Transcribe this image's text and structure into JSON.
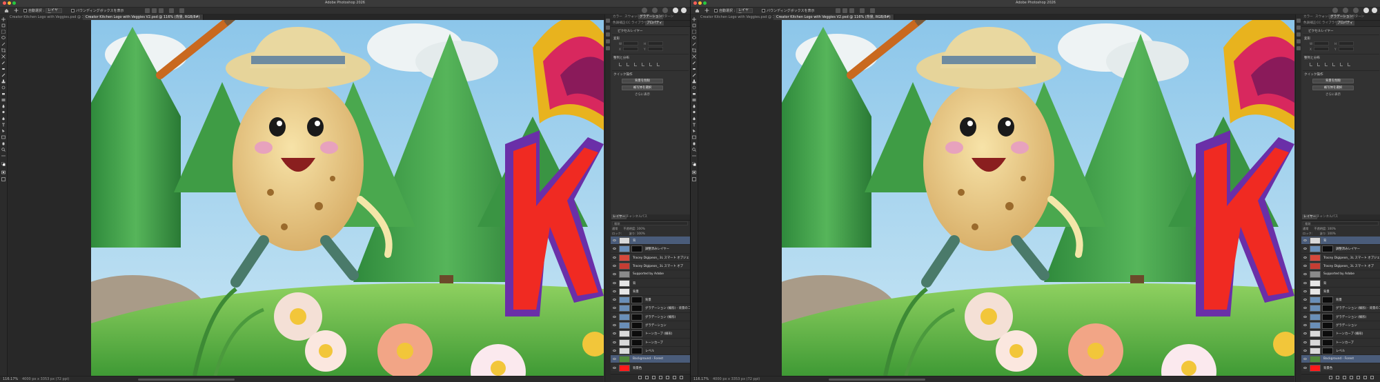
{
  "app": {
    "title": "Adobe Photoshop 2026"
  },
  "options_bar": {
    "auto_select_label": "自動選択 :",
    "auto_select_value": "レイヤー",
    "transform_controls_label": "バウンディングボックスを表示"
  },
  "document_tabs": [
    {
      "label": "Creator Kitchen Logo with Veggies.psd @ 100% (RGB/8#)",
      "active": false
    },
    {
      "label": "Creator Kitchen Logo with Veggies V2.psd @ 116% (背景, RGB/8#)",
      "active": true
    }
  ],
  "status_bar": {
    "zoom": "116.17%",
    "dimensions": "4000 px x 3353 px (72 ppi)"
  },
  "panels": {
    "top_tabs_row1": [
      "カラー",
      "スウォッチ",
      "グラデーション",
      "パターン"
    ],
    "top_tabs_row2": [
      "色調補正",
      "CC ライブラリ",
      "プロパティ"
    ],
    "properties": {
      "pixel_layer_label": "ピクセルレイヤー",
      "transform_header": "変形",
      "w_label": "W",
      "h_label": "H",
      "x_label": "X",
      "y_label": "Y",
      "align_header": "整列と分布",
      "quick_actions_header": "クイック操作",
      "remove_background_button": "背景を削除",
      "select_subject_button": "被写体を選択",
      "more_link": "さらに表示"
    },
    "layers": {
      "tabs": [
        "レイヤー",
        "チャンネル",
        "パス"
      ],
      "filter_label": "種類",
      "mode": "通常",
      "opacity_label": "不透明度: 100%",
      "lock_label": "ロック:",
      "fill_label": "塗り: 100%",
      "rows": [
        {
          "name": "背",
          "selected": true,
          "thumb_color": "#d9d9d9",
          "has_mask": false,
          "indent": false
        },
        {
          "name": "調整済みレイヤー",
          "selected": false,
          "thumb_color": "#6a8fb8",
          "has_mask": true,
          "indent": false
        },
        {
          "name": "Tracey Digipeon_ 3L スマート オブジェ",
          "selected": false,
          "thumb_color": "#d7493c",
          "has_mask": false,
          "indent": false
        },
        {
          "name": "Tracey Digipeon_ 3L スマート オブ",
          "selected": false,
          "thumb_color": "#c63d33",
          "has_mask": false,
          "indent": false
        },
        {
          "name": "Supported by Adobe",
          "selected": false,
          "thumb_color": "#8a8a8a",
          "has_mask": false,
          "indent": false
        },
        {
          "name": "背",
          "selected": false,
          "thumb_color": "#e6e6e6",
          "has_mask": false,
          "indent": false
        },
        {
          "name": "背景",
          "selected": false,
          "thumb_color": "#e6e6e6",
          "has_mask": false,
          "indent": false
        },
        {
          "name": "背景",
          "selected": false,
          "thumb_color": "#6a8fb8",
          "has_mask": true,
          "indent": false
        },
        {
          "name": "グラデーション (線形) - 背景のコピー",
          "selected": false,
          "thumb_color": "#6a8fb8",
          "has_mask": true,
          "indent": false
        },
        {
          "name": "グラデーション (線形)",
          "selected": false,
          "thumb_color": "#6a8fb8",
          "has_mask": true,
          "indent": false
        },
        {
          "name": "グラデーション",
          "selected": false,
          "thumb_color": "#6a8fb8",
          "has_mask": true,
          "indent": false
        },
        {
          "name": "トーンカーブ (線形)",
          "selected": false,
          "thumb_color": "#d9d9d9",
          "has_mask": true,
          "indent": false
        },
        {
          "name": "トーンカーブ",
          "selected": false,
          "thumb_color": "#d9d9d9",
          "has_mask": true,
          "indent": false
        },
        {
          "name": "レベル",
          "selected": false,
          "thumb_color": "#d9d9d9",
          "has_mask": true,
          "indent": false
        },
        {
          "name": "Background - Forest",
          "selected": true,
          "thumb_color": "#4f8a3a",
          "has_mask": false,
          "indent": false
        },
        {
          "name": "背景色",
          "selected": false,
          "thumb_color": "#ff1a1a",
          "has_mask": false,
          "indent": false
        }
      ]
    }
  },
  "colors": {
    "accent_selected": "#4a5c7a",
    "traffic_red": "#ff5f57",
    "traffic_yellow": "#febc2e",
    "traffic_green": "#28c840"
  }
}
